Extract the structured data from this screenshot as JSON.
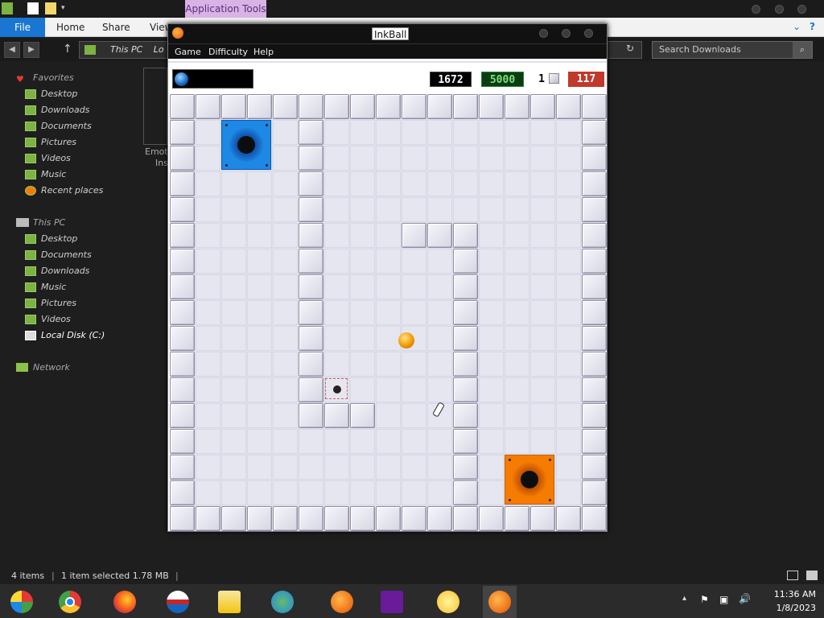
{
  "explorer": {
    "ribbon_context_tab": "Application Tools",
    "tabs": [
      "File",
      "Home",
      "Share",
      "View"
    ],
    "breadcrumb": [
      "This PC",
      "Lo"
    ],
    "search_placeholder": "Search Downloads",
    "sidebar": {
      "favorites_label": "Favorites",
      "favorites": [
        "Desktop",
        "Downloads",
        "Documents",
        "Pictures",
        "Videos",
        "Music",
        "Recent places"
      ],
      "thispc_label": "This PC",
      "thispc": [
        "Desktop",
        "Documents",
        "Downloads",
        "Music",
        "Pictures",
        "Videos",
        "Local Disk (C:)"
      ],
      "network_label": "Network"
    },
    "file_item_label_1": "Emot",
    "file_item_label_2": "Ins",
    "status": {
      "items": "4 items",
      "selected": "1 item selected  1.78 MB"
    }
  },
  "inkball": {
    "title": "InkBall",
    "menu": [
      "Game",
      "Difficulty",
      "Help"
    ],
    "hud": {
      "time_remaining": "1672",
      "score": "5000",
      "lives_count": "1",
      "high_score": "117",
      "time_color": "#000000",
      "score_color": "#0a3d0a",
      "high_color": "#c0392b"
    },
    "board": {
      "cols": 17,
      "rows": 17,
      "holes": [
        {
          "color": "blue",
          "col": 2,
          "row": 1
        },
        {
          "color": "orange",
          "col": 13,
          "row": 14
        }
      ]
    }
  },
  "taskbar": {
    "icons": [
      "windows-start-icon",
      "chrome-icon",
      "firefox-icon",
      "obama-icon",
      "file-explorer-icon",
      "network-people-icon",
      "inkball-app-icon",
      "visual-studio-icon",
      "smiley-icon",
      "inkball-active-icon"
    ],
    "time": "11:36 AM",
    "date": "1/8/2023"
  }
}
